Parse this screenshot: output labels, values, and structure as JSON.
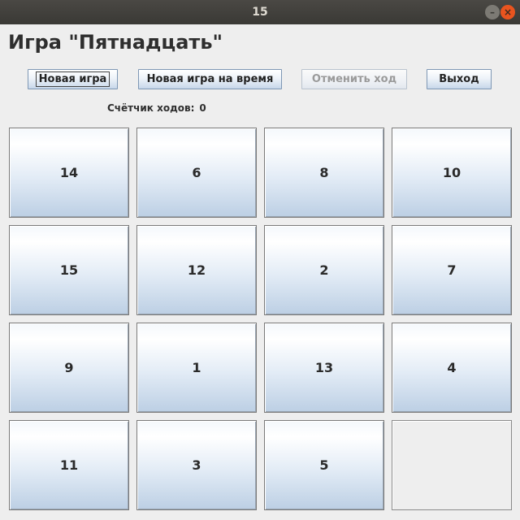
{
  "window": {
    "title": "15",
    "minimize_glyph": "–",
    "close_glyph": "×"
  },
  "heading": "Игра \"Пятнадцать\"",
  "toolbar": {
    "new_game": "Новая игра",
    "new_timed_game": "Новая игра на время",
    "undo": "Отменить ход",
    "exit": "Выход"
  },
  "counter": {
    "label": "Счётчик ходов:",
    "value": "0"
  },
  "board": {
    "tiles": [
      "14",
      "6",
      "8",
      "10",
      "15",
      "12",
      "2",
      "7",
      "9",
      "1",
      "13",
      "4",
      "11",
      "3",
      "5",
      ""
    ]
  }
}
